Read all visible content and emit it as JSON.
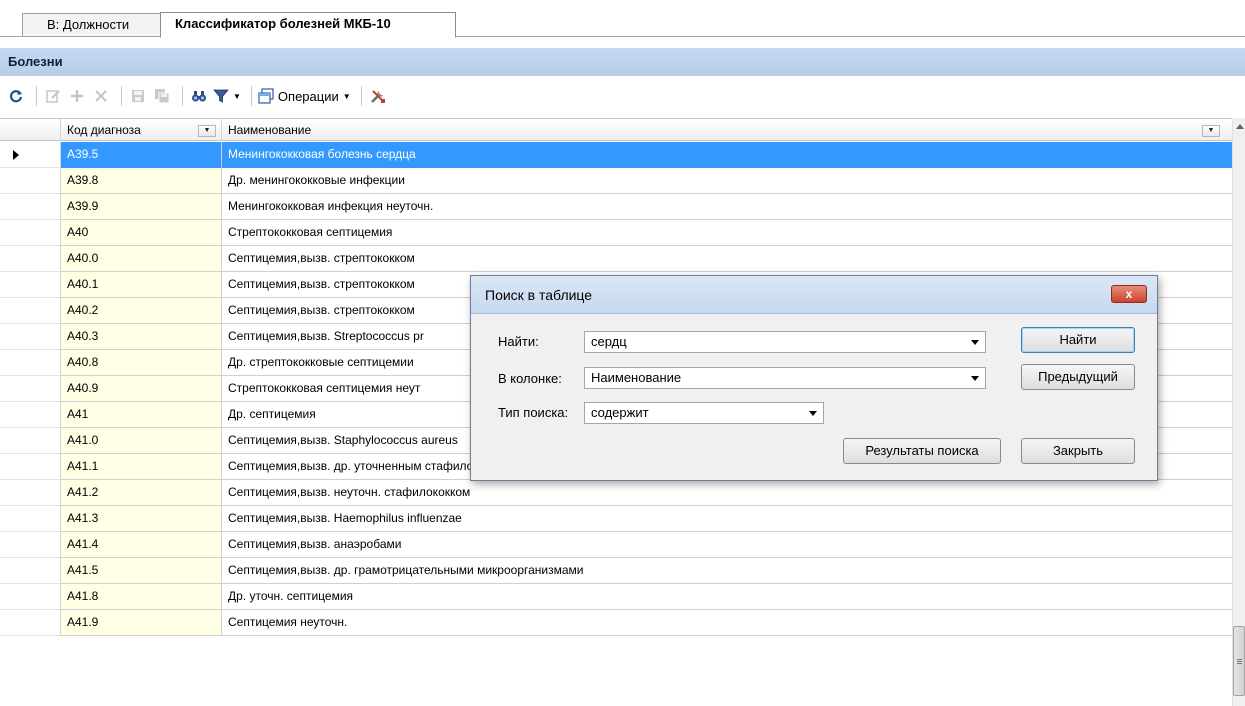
{
  "tabs": [
    {
      "label": "В: Должности",
      "active": false
    },
    {
      "label": "Классификатор болезней МКБ-10",
      "active": true
    }
  ],
  "section": {
    "title": "Болезни"
  },
  "toolbar": {
    "operations_label": "Операции",
    "icons": [
      "refresh-icon",
      "edit-icon",
      "add-icon",
      "delete-icon",
      "save-icon",
      "save-all-icon",
      "find-icon",
      "filter-icon",
      "operations-icon",
      "settings-icon"
    ]
  },
  "grid": {
    "columns": {
      "code": "Код диагноза",
      "name": "Наименование"
    },
    "rows": [
      {
        "code": "A39.5",
        "name": "Менингококковая болезнь сердца",
        "selected": true
      },
      {
        "code": "A39.8",
        "name": "Др. менингококковые инфекции"
      },
      {
        "code": "A39.9",
        "name": "Менингококковая инфекция неуточн."
      },
      {
        "code": "A40",
        "name": "Стрептококковая септицемия"
      },
      {
        "code": "A40.0",
        "name": "Септицемия,вызв. стрептококком"
      },
      {
        "code": "A40.1",
        "name": "Септицемия,вызв. стрептококком"
      },
      {
        "code": "A40.2",
        "name": "Септицемия,вызв. стрептококком"
      },
      {
        "code": "A40.3",
        "name": "Септицемия,вызв. Streptococcus pr"
      },
      {
        "code": "A40.8",
        "name": "Др. стрептококковые септицемии"
      },
      {
        "code": "A40.9",
        "name": "Стрептококковая септицемия неут"
      },
      {
        "code": "A41",
        "name": "Др. септицемия"
      },
      {
        "code": "A41.0",
        "name": "Септицемия,вызв. Staphylococcus aureus"
      },
      {
        "code": "A41.1",
        "name": "Септицемия,вызв. др. уточненным стафилококком"
      },
      {
        "code": "A41.2",
        "name": "Септицемия,вызв. неуточн. стафилококком"
      },
      {
        "code": "A41.3",
        "name": "Септицемия,вызв. Haemophilus influenzae"
      },
      {
        "code": "A41.4",
        "name": "Септицемия,вызв. анаэробами"
      },
      {
        "code": "A41.5",
        "name": "Септицемия,вызв. др. грамотрицательными микроорганизмами"
      },
      {
        "code": "A41.8",
        "name": "Др. уточн. септицемия"
      },
      {
        "code": "A41.9",
        "name": "Септицемия неуточн."
      }
    ]
  },
  "dialog": {
    "title": "Поиск в таблице",
    "close_symbol": "x",
    "find_label": "Найти:",
    "find_value": "сердц",
    "column_label": "В колонке:",
    "column_value": "Наименование",
    "search_type_label": "Тип поиска:",
    "search_type_value": "содержит",
    "find_button": "Найти",
    "previous_button": "Предыдущий",
    "results_button": "Результаты поиска",
    "close_button": "Закрыть"
  },
  "colors": {
    "selection": "#3399ff",
    "code_column_bg": "#ffffe6",
    "section_header_bg": "#c6d9f0"
  }
}
